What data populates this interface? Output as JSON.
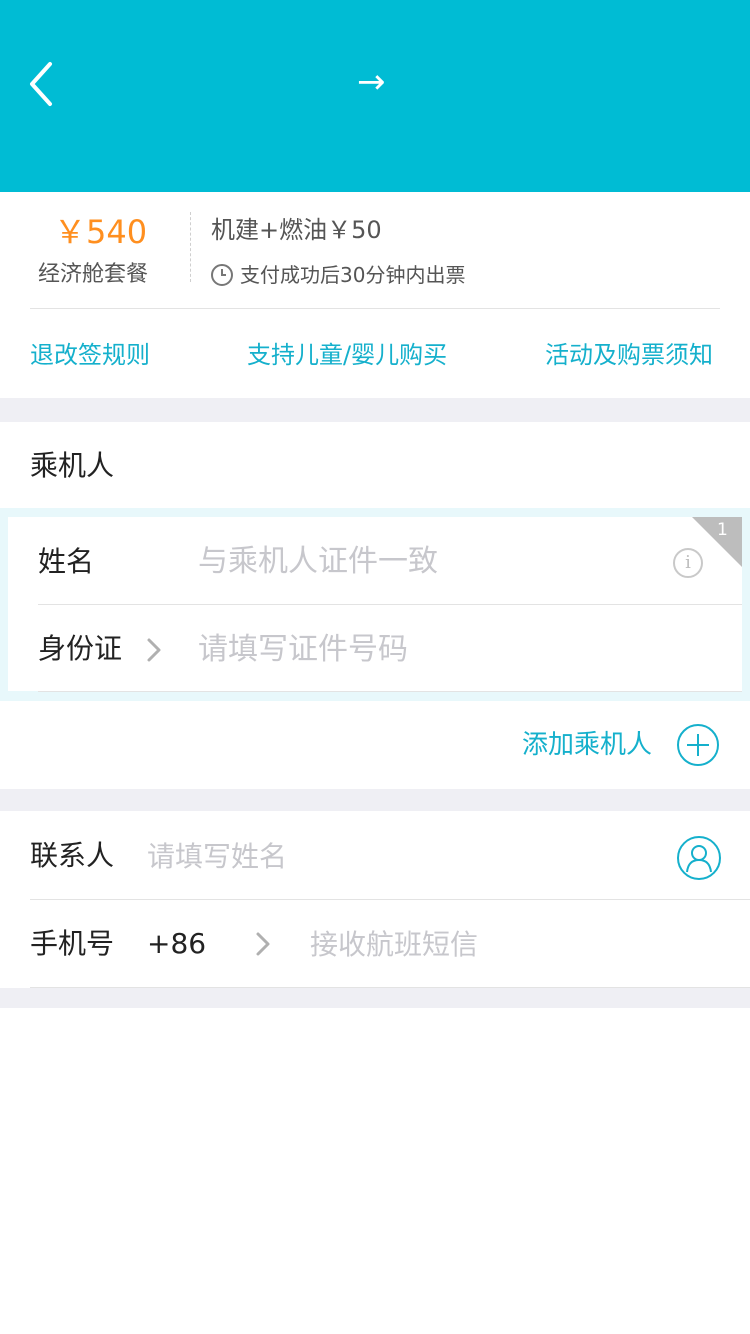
{
  "header": {
    "arrow": "→"
  },
  "fare": {
    "price": "￥540",
    "package": "经济舱套餐",
    "tax": "机建+燃油￥50",
    "issue_note": "支付成功后30分钟内出票"
  },
  "links": [
    "退改签规则",
    "支持儿童/婴儿购买",
    "活动及购票须知"
  ],
  "passenger_section": {
    "title": "乘机人",
    "index_badge": "1",
    "name_label": "姓名",
    "name_placeholder": "与乘机人证件一致",
    "id_label": "身份证",
    "id_placeholder": "请填写证件号码",
    "add_label": "添加乘机人"
  },
  "contact_section": {
    "contact_label": "联系人",
    "contact_placeholder": "请填写姓名",
    "phone_label": "手机号",
    "country_code": "+86",
    "phone_placeholder": "接收航班短信"
  },
  "colors": {
    "header": "#00bcd4",
    "accent": "#15b0cc",
    "price": "#ff8f1f"
  }
}
